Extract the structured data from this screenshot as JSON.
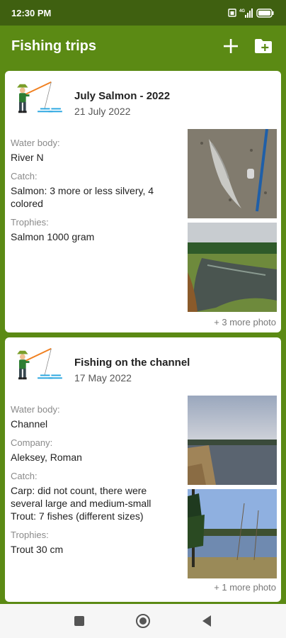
{
  "status_bar": {
    "time": "12:30 PM",
    "battery": "85"
  },
  "app_bar": {
    "title": "Fishing trips"
  },
  "trips": [
    {
      "title": "July Salmon - 2022",
      "date": "21 July 2022",
      "fields": [
        {
          "label": "Water body:",
          "value": "River N"
        },
        {
          "label": "Catch:",
          "value": "Salmon: 3 more or less silvery, 4 colored"
        },
        {
          "label": "Trophies:",
          "value": "Salmon 1000 gram"
        }
      ],
      "more_photos": "+ 3 more photo"
    },
    {
      "title": "Fishing on the channel",
      "date": "17 May 2022",
      "fields": [
        {
          "label": "Water body:",
          "value": "Channel"
        },
        {
          "label": "Company:",
          "value": "Aleksey, Roman"
        },
        {
          "label": "Catch:",
          "value": "Carp: did not count, there were several large and medium-small\nTrout: 7 fishes (different sizes)"
        },
        {
          "label": "Trophies:",
          "value": "Trout 30 cm"
        }
      ],
      "more_photos": "+ 1 more photo"
    }
  ],
  "icons": {
    "add": "plus-icon",
    "add_folder": "folder-add-icon",
    "nav": [
      "square-nav-icon",
      "circle-home-icon",
      "triangle-back-icon"
    ]
  },
  "colors": {
    "status_bar": "#3f6010",
    "app_bar": "#5b8a14",
    "card": "#ffffff",
    "nav_bar": "#f6f6f6"
  }
}
